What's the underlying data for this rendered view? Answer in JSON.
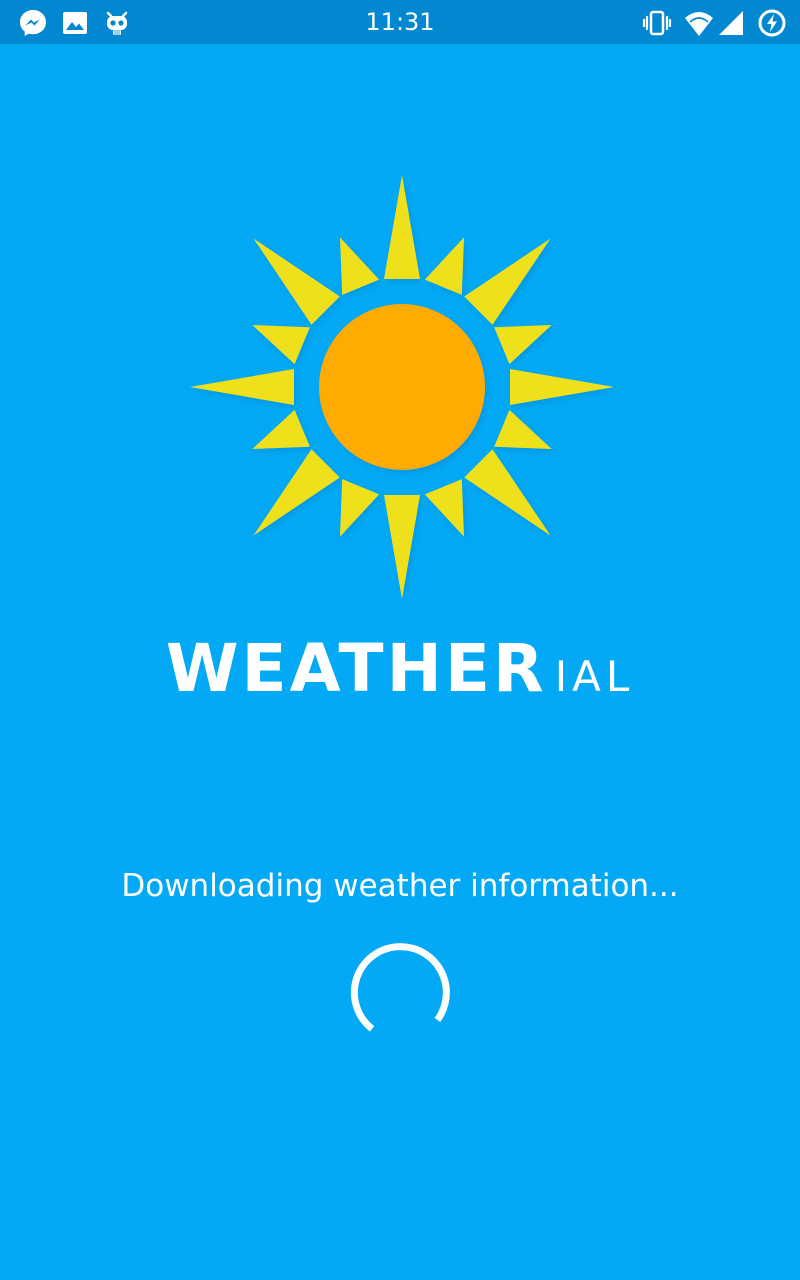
{
  "status_bar": {
    "time": "11:31",
    "left_icons": [
      "messenger-icon",
      "gallery-icon",
      "cyanogenmod-icon"
    ],
    "right_icons": [
      "vibrate-icon",
      "wifi-icon",
      "cellular-signal-icon",
      "battery-charging-icon"
    ]
  },
  "brand": {
    "main": "WEATHER",
    "suffix": "IAL"
  },
  "loading": {
    "message": "Downloading weather information..."
  },
  "colors": {
    "background": "#03A9F4",
    "status_bar": "#0288D1",
    "sun_core": "#FFAB00",
    "sun_rays": "#EEE11F",
    "text": "#FFFFFF"
  }
}
